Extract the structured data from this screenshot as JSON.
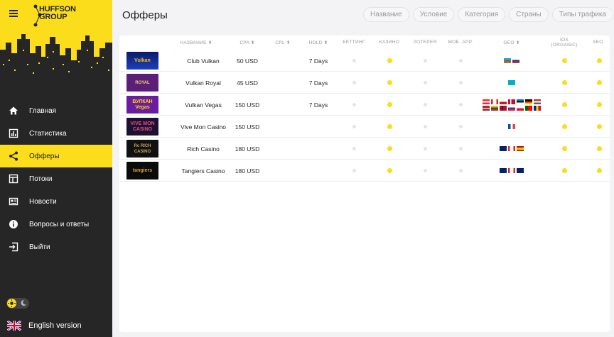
{
  "brand": {
    "name_line1": "HUFFSON",
    "name_line2": "GROUP"
  },
  "sidebar": {
    "items": [
      {
        "label": "Главная",
        "icon": "home-icon",
        "active": false
      },
      {
        "label": "Статистика",
        "icon": "chart-icon",
        "active": false
      },
      {
        "label": "Офферы",
        "icon": "share-icon",
        "active": true
      },
      {
        "label": "Потоки",
        "icon": "table-icon",
        "active": false
      },
      {
        "label": "Новости",
        "icon": "news-icon",
        "active": false
      },
      {
        "label": "Вопросы и ответы",
        "icon": "info-icon",
        "active": false
      },
      {
        "label": "Выйти",
        "icon": "logout-icon",
        "active": false
      }
    ],
    "language_label": "English version"
  },
  "header": {
    "title": "Офферы",
    "filters": [
      "Название",
      "Условие",
      "Категория",
      "Страны",
      "Типы трафика"
    ]
  },
  "table": {
    "columns": {
      "name": "НАЗВАНИЕ ⬍",
      "cpa": "CPA ⬍",
      "cpl": "CPL ⬍",
      "hold": "HOLD ⬍",
      "betting": "БЕТТИНГ",
      "casino": "КАЗИНО",
      "lottery": "ЛОТЕРЕЯ",
      "mobapp": "МОБ. APP.",
      "geo": "GEO ⬍",
      "ios_1": "IOS",
      "ios_2": "(ORGANIC)",
      "seo": "SEO"
    },
    "rows": [
      {
        "logo": "Vulkan",
        "name": "Club Vulkan",
        "cpa": "50 USD",
        "hold": "7 Days",
        "flags": [
          "AZ",
          "RU"
        ],
        "casino": true,
        "ios": true,
        "seo": true
      },
      {
        "logo": "ROYAL",
        "name": "Vulkan Royal",
        "cpa": "45 USD",
        "hold": "7 Days",
        "flags": [
          "KZ"
        ],
        "casino": true,
        "ios": true,
        "seo": true
      },
      {
        "logo": "ВУЛКАН Vegas",
        "name": "Vulkan Vegas",
        "cpa": "150 USD",
        "hold": "7 Days",
        "flags": [
          "AT",
          "CA",
          "CZ",
          "DK",
          "EE",
          "DE",
          "HU",
          "LV",
          "LT",
          "NO",
          "SK",
          "PL",
          "PT",
          "RO"
        ],
        "casino": true,
        "ios": true,
        "seo": true
      },
      {
        "logo": "VIVE MON CASINO",
        "name": "Vive Mon Casino",
        "cpa": "150 USD",
        "hold": "",
        "flags": [
          "FR"
        ],
        "casino": true,
        "ios": true,
        "seo": true
      },
      {
        "logo": "Rc RICH CASINO",
        "name": "Rich Casino",
        "cpa": "180 USD",
        "hold": "",
        "flags": [
          "AU",
          "CA",
          "ES"
        ],
        "casino": true,
        "ios": true,
        "seo": true
      },
      {
        "logo": "tangiers",
        "name": "Tangiers Casino",
        "cpa": "180 USD",
        "hold": "",
        "flags": [
          "AU",
          "CA",
          "NZ"
        ],
        "casino": true,
        "ios": true,
        "seo": true
      }
    ]
  },
  "colors": {
    "accent": "#fcdd1c",
    "sidebar_bg": "#262626",
    "dot_off": "#e4e4e4"
  }
}
